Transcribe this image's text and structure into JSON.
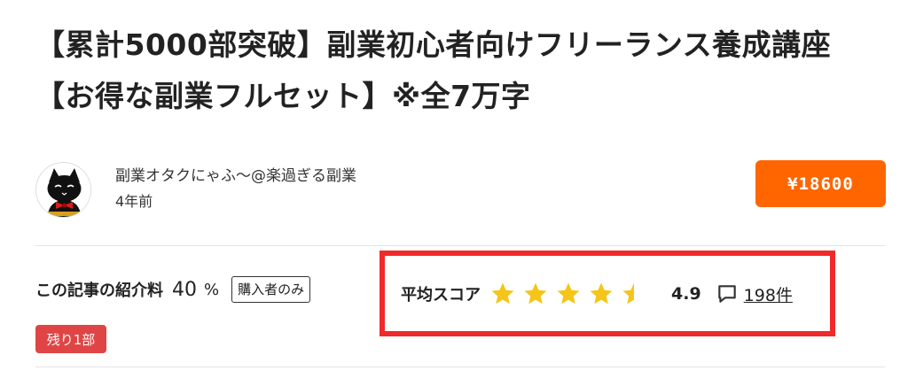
{
  "article": {
    "title": "【累計5000部突破】副業初心者向けフリーランス養成講座【お得な副業フルセット】※全7万字"
  },
  "author": {
    "name": "副業オタクにゃふ～@楽過ぎる副業",
    "posted": "4年前",
    "avatar_icon": "black-cat-avatar-icon"
  },
  "purchase": {
    "price_label": "¥18600",
    "button_color": "#ff6600"
  },
  "affiliate": {
    "label": "この記事の紹介料",
    "value": "40",
    "unit": "%",
    "badge": "購入者のみ"
  },
  "stock": {
    "remaining": "残り1部",
    "badge_color": "#e04545"
  },
  "rating": {
    "label": "平均スコア",
    "score": "4.9",
    "stars_filled": 4.5,
    "stars_total": 5,
    "star_color": "#f5c518",
    "review_count": "198件",
    "highlight_color": "#f02a2a"
  }
}
